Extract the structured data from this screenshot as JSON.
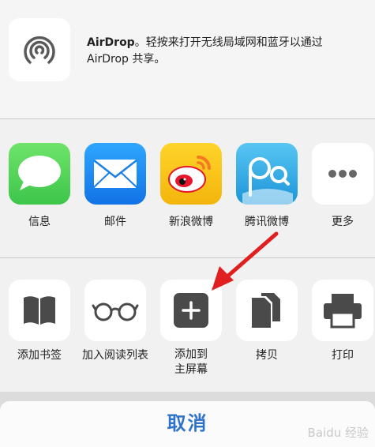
{
  "airdrop": {
    "icon": "airdrop-icon",
    "text_bold": "AirDrop",
    "text_rest": "。轻按来打开无线局域网和蓝牙以通过",
    "text_line2": "AirDrop 共享。"
  },
  "share_apps": [
    {
      "label": "信息",
      "icon": "messages-icon",
      "color": "#4cd964"
    },
    {
      "label": "邮件",
      "icon": "mail-icon",
      "color": "#1e8cf0"
    },
    {
      "label": "新浪微博",
      "icon": "weibo-icon",
      "color": "#f5c316"
    },
    {
      "label": "腾讯微博",
      "icon": "tencent-weibo-icon",
      "color": "#2aa1e0"
    },
    {
      "label": "更多",
      "icon": "more-icon",
      "color": "#ffffff"
    }
  ],
  "actions": [
    {
      "label": "添加书签",
      "icon": "book-icon"
    },
    {
      "label": "加入阅读列表",
      "icon": "glasses-icon"
    },
    {
      "label": "添加到",
      "label2": "主屏幕",
      "icon": "add-icon"
    },
    {
      "label": "拷贝",
      "icon": "copy-icon"
    },
    {
      "label": "打印",
      "icon": "print-icon"
    }
  ],
  "cancel_label": "取消",
  "watermark": "Baidu 经验",
  "arrow_color": "#e02020"
}
